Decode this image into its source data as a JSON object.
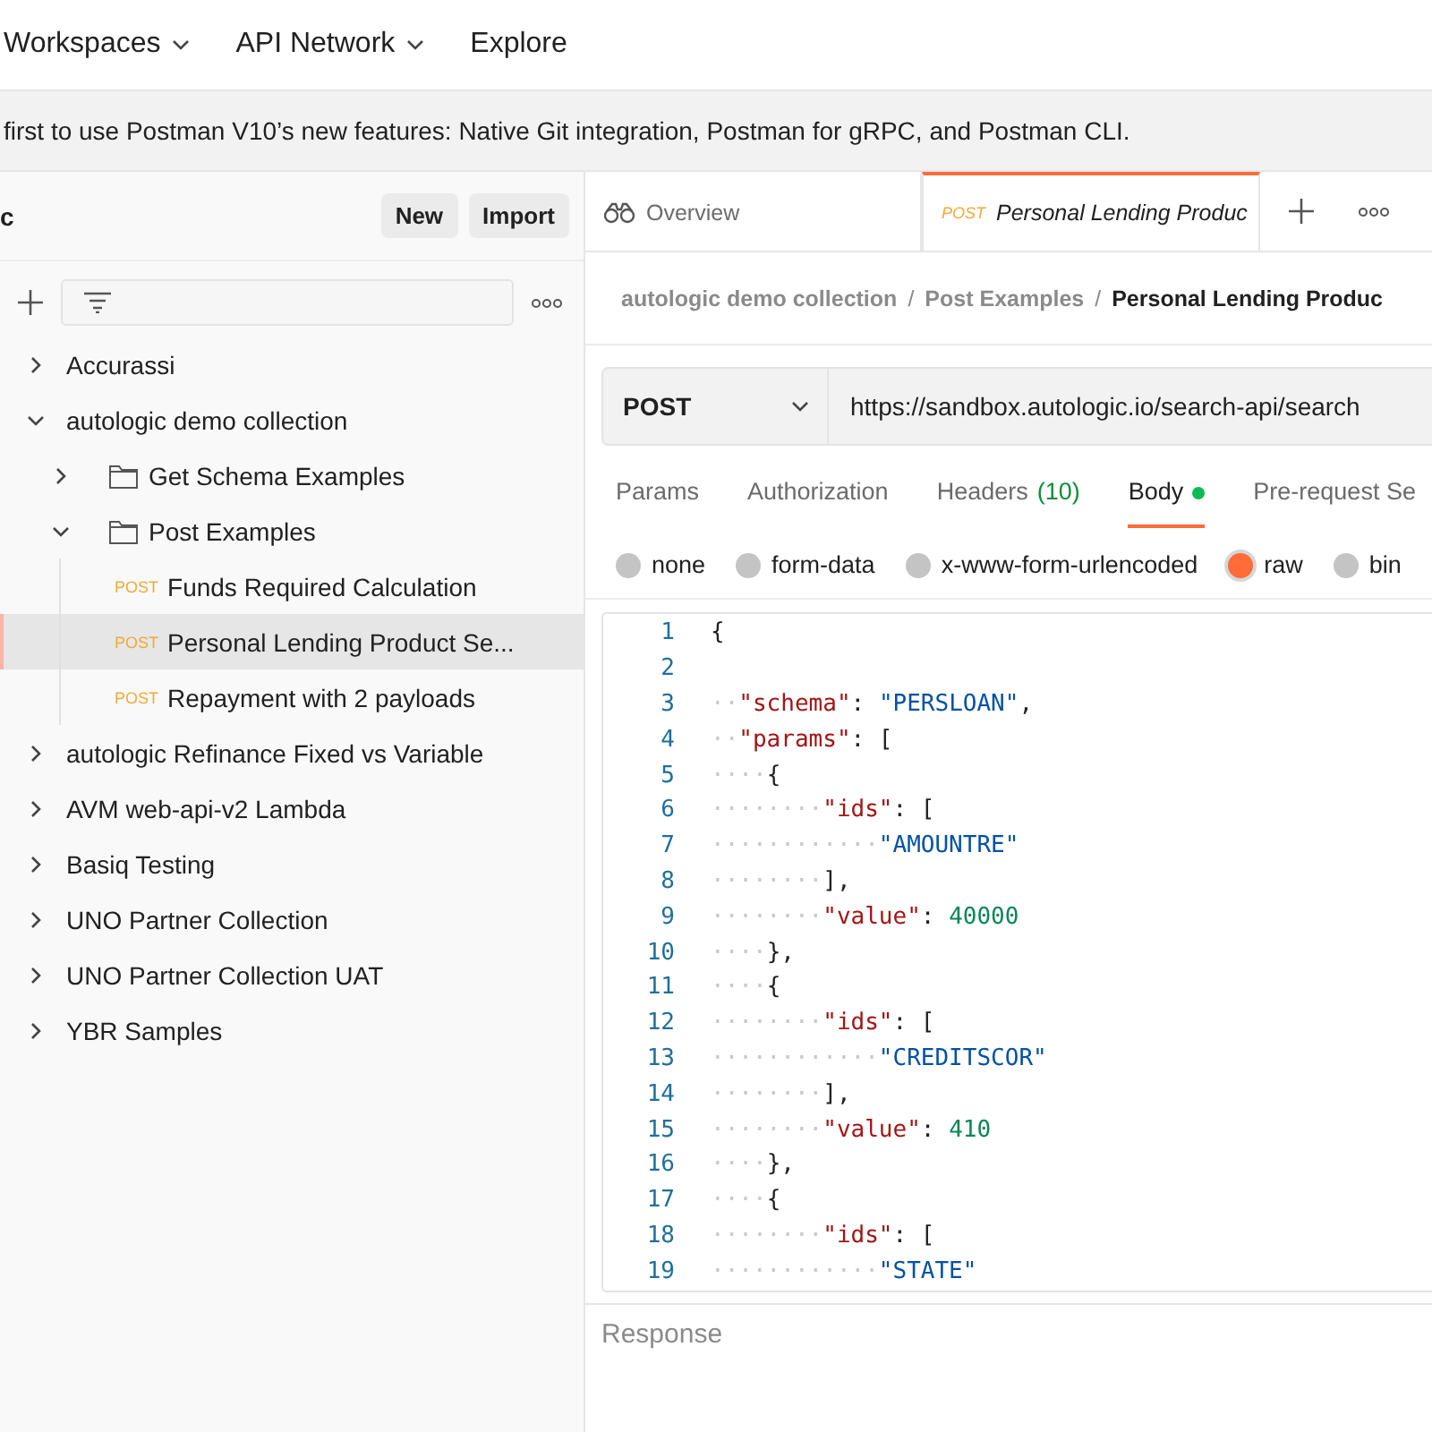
{
  "top_nav": [
    {
      "label": "Workspaces",
      "dropdown": true
    },
    {
      "label": "API Network",
      "dropdown": true
    },
    {
      "label": "Explore",
      "dropdown": false
    }
  ],
  "banner": {
    "text": "first to use Postman V10’s new features: Native Git integration, Postman for gRPC, and Postman CLI."
  },
  "sidebar": {
    "title": "c",
    "buttons": [
      "New",
      "Import"
    ],
    "tree": [
      {
        "label": "Accurassi",
        "kind": "collection",
        "expanded": false,
        "selected": false
      },
      {
        "label": "autologic demo collection",
        "kind": "collection",
        "expanded": true,
        "selected": false,
        "children": [
          {
            "label": "Get Schema Examples",
            "kind": "folder",
            "expanded": false,
            "selected": false
          },
          {
            "label": "Post Examples",
            "kind": "folder",
            "expanded": true,
            "selected": false,
            "children": [
              {
                "label": "Funds Required Calculation",
                "kind": "request",
                "method": "POST",
                "selected": false
              },
              {
                "label": "Personal Lending Product Se...",
                "kind": "request",
                "method": "POST",
                "selected": true
              },
              {
                "label": "Repayment with 2 payloads",
                "kind": "request",
                "method": "POST",
                "selected": false
              }
            ]
          }
        ]
      },
      {
        "label": "autologic Refinance Fixed vs Variable",
        "kind": "collection",
        "expanded": false,
        "selected": false
      },
      {
        "label": "AVM web-api-v2 Lambda",
        "kind": "collection",
        "expanded": false,
        "selected": false
      },
      {
        "label": "Basiq Testing",
        "kind": "collection",
        "expanded": false,
        "selected": false
      },
      {
        "label": "UNO Partner Collection",
        "kind": "collection",
        "expanded": false,
        "selected": false
      },
      {
        "label": "UNO Partner Collection UAT",
        "kind": "collection",
        "expanded": false,
        "selected": false
      },
      {
        "label": "YBR Samples",
        "kind": "collection",
        "expanded": false,
        "selected": false
      }
    ]
  },
  "tabs": [
    {
      "label": "Overview",
      "kind": "overview",
      "selected": false
    },
    {
      "label": "Personal Lending Produc",
      "kind": "request",
      "method": "POST",
      "selected": true
    }
  ],
  "breadcrumb": {
    "separator": "/",
    "items": [
      "autologic demo collection",
      "Post Examples",
      "Personal Lending Produc"
    ]
  },
  "request": {
    "method": "POST",
    "url": "https://sandbox.autologic.io/search-api/search"
  },
  "request_tabs": [
    {
      "label": "Params",
      "selected": false
    },
    {
      "label": "Authorization",
      "selected": false
    },
    {
      "label": "Headers",
      "count": "(10)",
      "selected": false
    },
    {
      "label": "Body",
      "dot": true,
      "selected": true
    },
    {
      "label": "Pre-request Se",
      "selected": false
    }
  ],
  "body_types": [
    {
      "label": "none",
      "selected": false
    },
    {
      "label": "form-data",
      "selected": false
    },
    {
      "label": "x-www-form-urlencoded",
      "selected": false
    },
    {
      "label": "raw",
      "selected": true
    },
    {
      "label": "bin",
      "selected": false
    }
  ],
  "code_lines": [
    {
      "number": "1",
      "tokens": [
        {
          "kind": "punct",
          "text": "{"
        }
      ]
    },
    {
      "number": "2"
    },
    {
      "number": "3",
      "tokens": [
        {
          "kind": "space",
          "text": "··"
        },
        {
          "kind": "key",
          "text": "\"schema\""
        },
        {
          "kind": "punct",
          "text": ": "
        },
        {
          "kind": "string",
          "text": "\"PERSLOAN\""
        },
        {
          "kind": "punct",
          "text": ","
        }
      ]
    },
    {
      "number": "4",
      "tokens": [
        {
          "kind": "space",
          "text": "··"
        },
        {
          "kind": "key",
          "text": "\"params\""
        },
        {
          "kind": "punct",
          "text": ": ["
        }
      ]
    },
    {
      "number": "5",
      "tokens": [
        {
          "kind": "space",
          "text": "····"
        },
        {
          "kind": "punct",
          "text": "{"
        }
      ]
    },
    {
      "number": "6",
      "tokens": [
        {
          "kind": "space",
          "text": "········"
        },
        {
          "kind": "key",
          "text": "\"ids\""
        },
        {
          "kind": "punct",
          "text": ": ["
        }
      ]
    },
    {
      "number": "7",
      "tokens": [
        {
          "kind": "space",
          "text": "············"
        },
        {
          "kind": "string",
          "text": "\"AMOUNTRE\""
        }
      ]
    },
    {
      "number": "8",
      "tokens": [
        {
          "kind": "space",
          "text": "········"
        },
        {
          "kind": "punct",
          "text": "],"
        }
      ]
    },
    {
      "number": "9",
      "tokens": [
        {
          "kind": "space",
          "text": "········"
        },
        {
          "kind": "key",
          "text": "\"value\""
        },
        {
          "kind": "punct",
          "text": ": "
        },
        {
          "kind": "number",
          "text": "40000"
        }
      ]
    },
    {
      "number": "10",
      "tokens": [
        {
          "kind": "space",
          "text": "····"
        },
        {
          "kind": "punct",
          "text": "},"
        }
      ]
    },
    {
      "number": "11",
      "tokens": [
        {
          "kind": "space",
          "text": "····"
        },
        {
          "kind": "punct",
          "text": "{"
        }
      ]
    },
    {
      "number": "12",
      "tokens": [
        {
          "kind": "space",
          "text": "········"
        },
        {
          "kind": "key",
          "text": "\"ids\""
        },
        {
          "kind": "punct",
          "text": ": ["
        }
      ]
    },
    {
      "number": "13",
      "tokens": [
        {
          "kind": "space",
          "text": "············"
        },
        {
          "kind": "string",
          "text": "\"CREDITSCOR\""
        }
      ]
    },
    {
      "number": "14",
      "tokens": [
        {
          "kind": "space",
          "text": "········"
        },
        {
          "kind": "punct",
          "text": "],"
        }
      ]
    },
    {
      "number": "15",
      "tokens": [
        {
          "kind": "space",
          "text": "········"
        },
        {
          "kind": "key",
          "text": "\"value\""
        },
        {
          "kind": "punct",
          "text": ": "
        },
        {
          "kind": "number",
          "text": "410"
        }
      ]
    },
    {
      "number": "16",
      "tokens": [
        {
          "kind": "space",
          "text": "····"
        },
        {
          "kind": "punct",
          "text": "},"
        }
      ]
    },
    {
      "number": "17",
      "tokens": [
        {
          "kind": "space",
          "text": "····"
        },
        {
          "kind": "punct",
          "text": "{"
        }
      ]
    },
    {
      "number": "18",
      "tokens": [
        {
          "kind": "space",
          "text": "········"
        },
        {
          "kind": "key",
          "text": "\"ids\""
        },
        {
          "kind": "punct",
          "text": ": ["
        }
      ]
    },
    {
      "number": "19",
      "tokens": [
        {
          "kind": "space",
          "text": "············"
        },
        {
          "kind": "string",
          "text": "\"STATE\""
        }
      ]
    }
  ],
  "response": {
    "title": "Response"
  }
}
